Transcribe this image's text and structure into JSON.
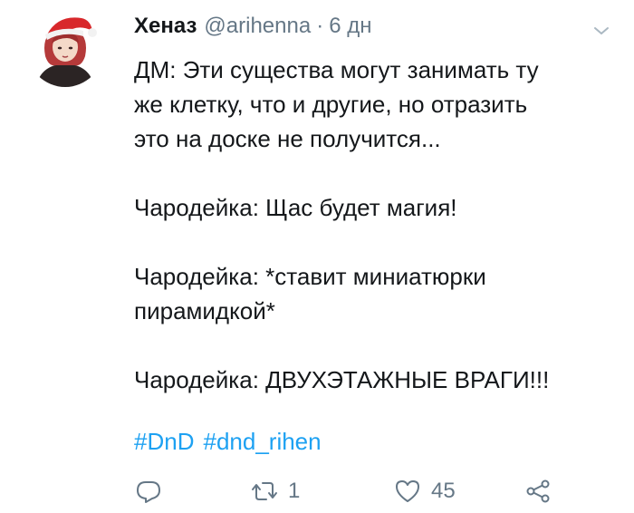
{
  "author": {
    "name": "Хеназ",
    "handle": "@arihenna",
    "separator": "·",
    "time": "6 дн"
  },
  "body": {
    "lines": [
      "ДМ: Эти существа могут занимать ту",
      "же клетку, что и другие, но отразить",
      "это на доске не получится...",
      "Чародейка: Щас будет магия!",
      "Чародейка: *ставит миниатюрки",
      "пирамидкой*",
      "Чародейка: ДВУХЭТАЖНЫЕ ВРАГИ!!!"
    ]
  },
  "hashtags": [
    "#DnD",
    "#dnd_rihen"
  ],
  "actions": {
    "reply_icon": "reply-icon",
    "retweet_icon": "retweet-icon",
    "retweet_count": "1",
    "like_icon": "heart-icon",
    "like_count": "45",
    "share_icon": "share-icon"
  },
  "colors": {
    "text": "#14171a",
    "secondary": "#657786",
    "link": "#1da1f2"
  }
}
